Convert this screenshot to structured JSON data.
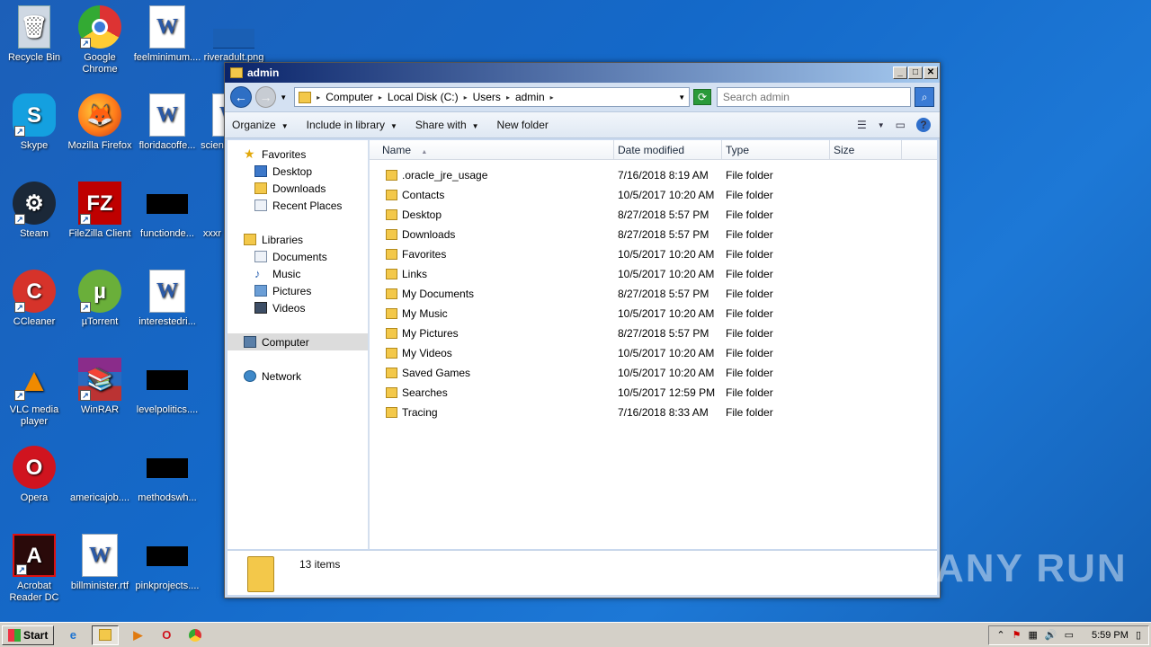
{
  "desktop": {
    "icons": [
      {
        "label": "Recycle Bin",
        "icon": "recycle-bin-icon"
      },
      {
        "label": "Google Chrome",
        "icon": "chrome-icon"
      },
      {
        "label": "feelminimum....",
        "icon": "word-doc-icon"
      },
      {
        "label": "riveradult.png",
        "icon": "image-file-icon"
      },
      {
        "label": "Skype",
        "icon": "skype-icon"
      },
      {
        "label": "Mozilla Firefox",
        "icon": "firefox-icon"
      },
      {
        "label": "floridacoffe...",
        "icon": "word-doc-icon"
      },
      {
        "label": "scien",
        "icon": "word-doc-icon"
      },
      {
        "label": "Steam",
        "icon": "steam-icon"
      },
      {
        "label": "FileZilla Client",
        "icon": "filezilla-icon"
      },
      {
        "label": "functionde...",
        "icon": "black-file-icon"
      },
      {
        "label": "xxxr",
        "icon": "file-icon"
      },
      {
        "label": "CCleaner",
        "icon": "ccleaner-icon"
      },
      {
        "label": "µTorrent",
        "icon": "utorrent-icon"
      },
      {
        "label": "interestedri...",
        "icon": "word-doc-icon"
      },
      {
        "label": "VLC media player",
        "icon": "vlc-icon"
      },
      {
        "label": "WinRAR",
        "icon": "winrar-icon"
      },
      {
        "label": "levelpolitics....",
        "icon": "black-file-icon"
      },
      {
        "label": "Opera",
        "icon": "opera-icon"
      },
      {
        "label": "americajob....",
        "icon": "file-icon"
      },
      {
        "label": "methodswh...",
        "icon": "black-file-icon"
      },
      {
        "label": "Acrobat Reader DC",
        "icon": "acrobat-icon"
      },
      {
        "label": "billminister.rtf",
        "icon": "word-doc-icon"
      },
      {
        "label": "pinkprojects....",
        "icon": "black-file-icon"
      }
    ]
  },
  "window": {
    "title": "admin",
    "controls": {
      "minimize": "_",
      "maximize": "□",
      "close": "✕"
    }
  },
  "address": {
    "crumbs": [
      "Computer",
      "Local Disk (C:)",
      "Users",
      "admin"
    ],
    "search_placeholder": "Search admin"
  },
  "toolbar": {
    "organize": "Organize",
    "include_in_library": "Include in library",
    "share_with": "Share with",
    "new_folder": "New folder"
  },
  "navpane": {
    "favorites": "Favorites",
    "desktop": "Desktop",
    "downloads": "Downloads",
    "recent_places": "Recent Places",
    "libraries": "Libraries",
    "documents": "Documents",
    "music": "Music",
    "pictures": "Pictures",
    "videos": "Videos",
    "computer": "Computer",
    "network": "Network"
  },
  "columns": {
    "name": "Name",
    "date": "Date modified",
    "type": "Type",
    "size": "Size"
  },
  "files": [
    {
      "name": ".oracle_jre_usage",
      "date": "7/16/2018 8:19 AM",
      "type": "File folder"
    },
    {
      "name": "Contacts",
      "date": "10/5/2017 10:20 AM",
      "type": "File folder"
    },
    {
      "name": "Desktop",
      "date": "8/27/2018 5:57 PM",
      "type": "File folder"
    },
    {
      "name": "Downloads",
      "date": "8/27/2018 5:57 PM",
      "type": "File folder"
    },
    {
      "name": "Favorites",
      "date": "10/5/2017 10:20 AM",
      "type": "File folder"
    },
    {
      "name": "Links",
      "date": "10/5/2017 10:20 AM",
      "type": "File folder"
    },
    {
      "name": "My Documents",
      "date": "8/27/2018 5:57 PM",
      "type": "File folder"
    },
    {
      "name": "My Music",
      "date": "10/5/2017 10:20 AM",
      "type": "File folder"
    },
    {
      "name": "My Pictures",
      "date": "8/27/2018 5:57 PM",
      "type": "File folder"
    },
    {
      "name": "My Videos",
      "date": "10/5/2017 10:20 AM",
      "type": "File folder"
    },
    {
      "name": "Saved Games",
      "date": "10/5/2017 10:20 AM",
      "type": "File folder"
    },
    {
      "name": "Searches",
      "date": "10/5/2017 12:59 PM",
      "type": "File folder"
    },
    {
      "name": "Tracing",
      "date": "7/16/2018 8:33 AM",
      "type": "File folder"
    }
  ],
  "status": {
    "items_count": "13 items"
  },
  "watermark": "ANY RUN",
  "taskbar": {
    "start": "Start",
    "clock": "5:59 PM"
  },
  "colors": {
    "desktop_bg": "#1469c9",
    "title_bar_start": "#0a246a",
    "title_bar_end": "#a6caf0",
    "folder": "#f3c84a",
    "taskbar": "#d4d0c8"
  }
}
